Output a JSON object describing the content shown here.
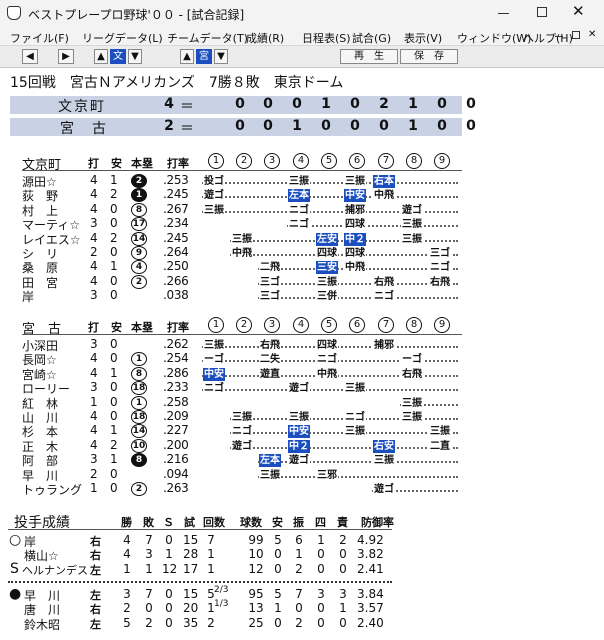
{
  "window": {
    "title": "ベストプレープロ野球'００ - [試合記録]"
  },
  "menu": [
    "ファイル(F)",
    "リーグデータ(L)",
    "チームデータ(T)",
    "成績(R)",
    "日程表(S)",
    "試合(G)",
    "表示(V)",
    "ウィンドウ(W)",
    "ヘルプ(H)"
  ],
  "toolbar": {
    "team_a": "文",
    "team_b": "宮",
    "replay": "再　生",
    "save": "保　存"
  },
  "game": {
    "header": "15回戦　宮古Ｎアメリカンズ　7勝８敗　東京ドーム"
  },
  "linescore": [
    {
      "team": "文京町",
      "runs": "4",
      "innings": [
        "0",
        "0",
        "0",
        "1",
        "0",
        "2",
        "1",
        "0",
        "0"
      ]
    },
    {
      "team": "宮　古",
      "runs": "2",
      "innings": [
        "0",
        "0",
        "1",
        "0",
        "0",
        "0",
        "1",
        "0",
        "0"
      ]
    }
  ],
  "columns": {
    "bat": "打",
    "hit": "安",
    "hr": "本塁",
    "avg": "打率",
    "innings": [
      "1",
      "2",
      "3",
      "4",
      "5",
      "6",
      "7",
      "8",
      "9"
    ]
  },
  "pitching_headers": {
    "title": "投手成績",
    "cols": [
      "勝",
      "敗",
      "Ｓ",
      "試",
      "回数",
      "球数",
      "安",
      "振",
      "四",
      "責",
      "防御率"
    ]
  },
  "batting_top": {
    "team": "文京町",
    "rows": [
      {
        "name": "源田☆",
        "ab": "4",
        "h": "1",
        "hr": "2",
        "hrf": true,
        "avg": ".253",
        "res": [
          {
            "i": 1,
            "t": "投ゴ"
          },
          {
            "i": 4,
            "t": "三振"
          },
          {
            "i": 6,
            "t": "三振"
          },
          {
            "i": 7,
            "t": "右本",
            "hl": true
          }
        ]
      },
      {
        "name": "荻　野",
        "ab": "4",
        "h": "2",
        "hr": "1",
        "hrf": true,
        "avg": ".245",
        "res": [
          {
            "i": 1,
            "t": "遊ゴ"
          },
          {
            "i": 4,
            "t": "左本",
            "hl": true
          },
          {
            "i": 6,
            "t": "中安",
            "hl": true
          },
          {
            "i": 7,
            "t": "中飛"
          }
        ]
      },
      {
        "name": "村　上",
        "ab": "4",
        "h": "0",
        "hr": "8",
        "hrf": false,
        "avg": ".267",
        "res": [
          {
            "i": 1,
            "t": "三振"
          },
          {
            "i": 4,
            "t": "ニゴ"
          },
          {
            "i": 6,
            "t": "捕邪"
          },
          {
            "i": 8,
            "t": "遊ゴ"
          }
        ]
      },
      {
        "name": "マーティ☆",
        "ab": "3",
        "h": "0",
        "hr": "17",
        "hrf": false,
        "avg": ".234",
        "res": [
          {
            "i": 4,
            "t": "ニゴ"
          },
          {
            "i": 6,
            "t": "四球"
          },
          {
            "i": 8,
            "t": "三振"
          }
        ]
      },
      {
        "name": "レイエス☆",
        "ab": "4",
        "h": "2",
        "hr": "14",
        "hrf": false,
        "avg": ".245",
        "res": [
          {
            "i": 2,
            "t": "三振"
          },
          {
            "i": 5,
            "t": "左安",
            "hl": true
          },
          {
            "i": 6,
            "t": "中２",
            "hl": true
          },
          {
            "i": 8,
            "t": "三振"
          }
        ]
      },
      {
        "name": "シ　リ",
        "ab": "2",
        "h": "0",
        "hr": "9",
        "hrf": false,
        "avg": ".264",
        "res": [
          {
            "i": 2,
            "t": "中飛"
          },
          {
            "i": 5,
            "t": "四球"
          },
          {
            "i": 6,
            "t": "四球"
          },
          {
            "i": 9,
            "t": "三ゴ"
          }
        ]
      },
      {
        "name": "桑　原",
        "ab": "4",
        "h": "1",
        "hr": "4",
        "hrf": false,
        "avg": ".250",
        "res": [
          {
            "i": 3,
            "t": "二飛"
          },
          {
            "i": 5,
            "t": "三安",
            "hl": true
          },
          {
            "i": 6,
            "t": "中飛"
          },
          {
            "i": 9,
            "t": "ニゴ"
          }
        ]
      },
      {
        "name": "田　宮",
        "ab": "4",
        "h": "0",
        "hr": "2",
        "hrf": false,
        "avg": ".266",
        "res": [
          {
            "i": 3,
            "t": "三ゴ"
          },
          {
            "i": 5,
            "t": "三振"
          },
          {
            "i": 7,
            "t": "右飛"
          },
          {
            "i": 9,
            "t": "右飛"
          }
        ]
      },
      {
        "name": "岸",
        "ab": "3",
        "h": "0",
        "hr": "",
        "hrf": false,
        "avg": ".038",
        "res": [
          {
            "i": 3,
            "t": "三ゴ"
          },
          {
            "i": 5,
            "t": "三併"
          },
          {
            "i": 7,
            "t": "ニゴ"
          }
        ]
      }
    ]
  },
  "batting_bottom": {
    "team": "宮　古",
    "rows": [
      {
        "name": "小深田",
        "ab": "3",
        "h": "0",
        "hr": "",
        "hrf": false,
        "avg": ".262",
        "res": [
          {
            "i": 1,
            "t": "三振"
          },
          {
            "i": 3,
            "t": "右飛"
          },
          {
            "i": 5,
            "t": "四球"
          },
          {
            "i": 7,
            "t": "捕邪"
          }
        ]
      },
      {
        "name": "長岡☆",
        "ab": "4",
        "h": "0",
        "hr": "1",
        "hrf": false,
        "avg": ".254",
        "res": [
          {
            "i": 1,
            "t": "ーゴ"
          },
          {
            "i": 3,
            "t": "二失"
          },
          {
            "i": 5,
            "t": "ニゴ"
          },
          {
            "i": 8,
            "t": "ーゴ"
          }
        ]
      },
      {
        "name": "宮崎☆",
        "ab": "4",
        "h": "1",
        "hr": "8",
        "hrf": false,
        "avg": ".286",
        "res": [
          {
            "i": 1,
            "t": "中安",
            "hl": true
          },
          {
            "i": 3,
            "t": "遊直"
          },
          {
            "i": 5,
            "t": "中飛"
          },
          {
            "i": 8,
            "t": "右飛"
          }
        ]
      },
      {
        "name": "ローリー",
        "ab": "3",
        "h": "0",
        "hr": "18",
        "hrf": false,
        "avg": ".233",
        "res": [
          {
            "i": 1,
            "t": "ニゴ"
          },
          {
            "i": 4,
            "t": "遊ゴ"
          },
          {
            "i": 6,
            "t": "三振"
          }
        ]
      },
      {
        "name": "紅　林",
        "ab": "1",
        "h": "0",
        "hr": "1",
        "hrf": false,
        "avg": ".258",
        "res": [
          {
            "i": 8,
            "t": "三振"
          }
        ]
      },
      {
        "name": "山　川",
        "ab": "4",
        "h": "0",
        "hr": "18",
        "hrf": false,
        "avg": ".209",
        "res": [
          {
            "i": 2,
            "t": "三振"
          },
          {
            "i": 4,
            "t": "三振"
          },
          {
            "i": 6,
            "t": "ニゴ"
          },
          {
            "i": 8,
            "t": "三振"
          }
        ]
      },
      {
        "name": "杉　本",
        "ab": "4",
        "h": "1",
        "hr": "14",
        "hrf": false,
        "avg": ".227",
        "res": [
          {
            "i": 2,
            "t": "ニゴ"
          },
          {
            "i": 4,
            "t": "中安",
            "hl": true
          },
          {
            "i": 6,
            "t": "三振"
          },
          {
            "i": 9,
            "t": "三振"
          }
        ]
      },
      {
        "name": "正　木",
        "ab": "4",
        "h": "2",
        "hr": "10",
        "hrf": false,
        "avg": ".200",
        "res": [
          {
            "i": 2,
            "t": "遊ゴ"
          },
          {
            "i": 4,
            "t": "中２",
            "hl": true
          },
          {
            "i": 7,
            "t": "右安",
            "hl": true
          },
          {
            "i": 9,
            "t": "二直"
          }
        ]
      },
      {
        "name": "阿　部",
        "ab": "3",
        "h": "1",
        "hr": "8",
        "hrf": true,
        "avg": ".216",
        "res": [
          {
            "i": 3,
            "t": "左本",
            "hl": true
          },
          {
            "i": 4,
            "t": "遊ゴ"
          },
          {
            "i": 7,
            "t": "三振"
          }
        ]
      },
      {
        "name": "早　川",
        "ab": "2",
        "h": "0",
        "hr": "",
        "hrf": false,
        "avg": ".094",
        "res": [
          {
            "i": 3,
            "t": "三振"
          },
          {
            "i": 5,
            "t": "三邪"
          }
        ]
      },
      {
        "name": "トゥラング",
        "ab": "1",
        "h": "0",
        "hr": "2",
        "hrf": false,
        "avg": ".263",
        "res": [
          {
            "i": 7,
            "t": "遊ゴ"
          }
        ]
      }
    ]
  },
  "pitchers_top": [
    {
      "mark": "○",
      "name": "岸",
      "hand": "右",
      "w": "4",
      "l": "7",
      "s": "0",
      "g": "15",
      "ip": "7",
      "ipf": "",
      "np": "99",
      "h": "5",
      "so": "6",
      "bb": "1",
      "er": "2",
      "era": "4.92"
    },
    {
      "mark": "",
      "name": "横山☆",
      "hand": "右",
      "w": "4",
      "l": "3",
      "s": "1",
      "g": "28",
      "ip": "1",
      "ipf": "",
      "np": "10",
      "h": "0",
      "so": "1",
      "bb": "0",
      "er": "0",
      "era": "3.82"
    },
    {
      "mark": "S",
      "name": "ヘルナンデス",
      "hand": "左",
      "w": "1",
      "l": "1",
      "s": "12",
      "g": "17",
      "ip": "1",
      "ipf": "",
      "np": "12",
      "h": "0",
      "so": "2",
      "bb": "0",
      "er": "0",
      "era": "2.41"
    }
  ],
  "pitchers_bottom": [
    {
      "mark": "●",
      "name": "早　川",
      "hand": "左",
      "w": "3",
      "l": "7",
      "s": "0",
      "g": "15",
      "ip": "5",
      "ipf": "2/3",
      "np": "95",
      "h": "5",
      "so": "7",
      "bb": "3",
      "er": "3",
      "era": "3.84"
    },
    {
      "mark": "",
      "name": "唐　川",
      "hand": "右",
      "w": "2",
      "l": "0",
      "s": "0",
      "g": "20",
      "ip": "1",
      "ipf": "1/3",
      "np": "13",
      "h": "1",
      "so": "0",
      "bb": "0",
      "er": "1",
      "era": "3.57"
    },
    {
      "mark": "",
      "name": "鈴木昭",
      "hand": "左",
      "w": "5",
      "l": "2",
      "s": "0",
      "g": "35",
      "ip": "2",
      "ipf": "",
      "np": "25",
      "h": "0",
      "so": "2",
      "bb": "0",
      "er": "0",
      "era": "2.40"
    }
  ]
}
